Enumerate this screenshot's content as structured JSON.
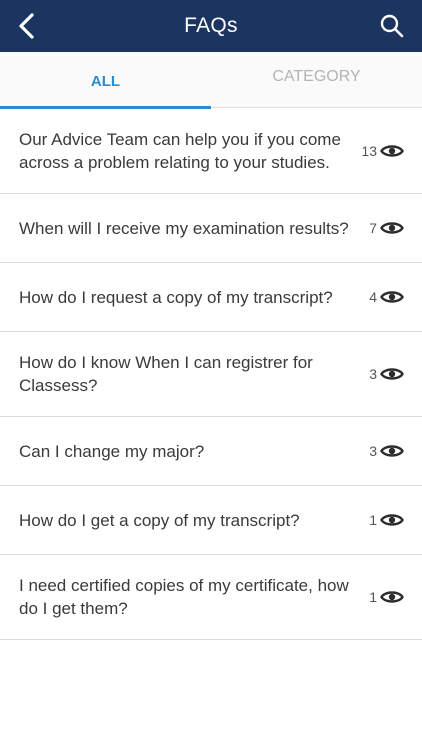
{
  "header": {
    "title": "FAQs"
  },
  "tabs": [
    {
      "label": "ALL",
      "active": true
    },
    {
      "label": "CATEGORY",
      "active": false
    }
  ],
  "faqs": [
    {
      "text": "Our Advice Team can help you if you come across a problem relating to your studies.",
      "views": "13"
    },
    {
      "text": "When will I receive my examination results?",
      "views": "7"
    },
    {
      "text": "How do I request a copy of my transcript?",
      "views": "4"
    },
    {
      "text": "How do I know When I can registrer for Classess?",
      "views": "3"
    },
    {
      "text": "Can I change my major?",
      "views": "3"
    },
    {
      "text": "How do I get a copy of my transcript?",
      "views": "1"
    },
    {
      "text": "I need certified copies of my certificate, how do I get them?",
      "views": "1"
    }
  ],
  "colors": {
    "header_bg": "#1b3560",
    "accent": "#2a8bd0"
  }
}
